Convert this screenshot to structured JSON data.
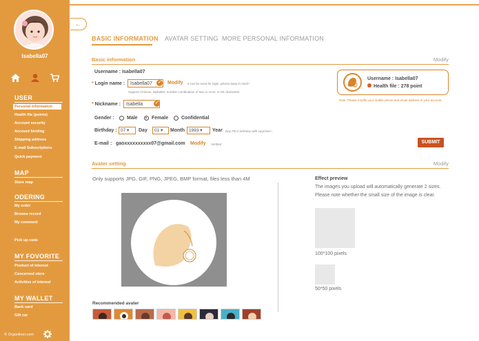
{
  "sidebar": {
    "username": "Isabella07",
    "sections": [
      {
        "title": "USER",
        "items": [
          "Personal information",
          "Health file (points)",
          "Account security",
          "Account binding",
          "Shipping address",
          "E-mail Subscriptions",
          "Quick payment"
        ]
      },
      {
        "title": "MAP",
        "items": [
          "Store map"
        ]
      },
      {
        "title": "ODERING",
        "items": [
          "My order",
          "Browse record",
          "My comment",
          "Pick up code"
        ]
      },
      {
        "title": "MY FOVORITE",
        "items": [
          "Product of interest",
          "Concerned store",
          "Activities of interest"
        ]
      },
      {
        "title": "MY WALLET",
        "items": [
          "Bank card",
          "Gift car"
        ]
      }
    ],
    "active_item": "Personal information",
    "footer": "© Organikon.com"
  },
  "tabs": [
    "BASIC INFORMATION",
    "AVATAR SETTING",
    "MORE PERSONAL INFORMATION"
  ],
  "active_tab": "BASIC INFORMATION",
  "basic": {
    "section_title": "Basic information",
    "modify": "Modify",
    "username_label": "Username :",
    "username_value": "Isabella07",
    "login_label": "Login name :",
    "login_value": "Isabella07",
    "login_modify": "Modify",
    "login_hint": "It can be used for login, please keep in mind~",
    "login_support": "Support Chinese, alphabet, number combination of two or more, 4~20 characters",
    "nickname_label": "Nickname :",
    "nickname_value": "Isabella",
    "gender_label": "Gender :",
    "gender_options": [
      "Male",
      "Female",
      "Confidential"
    ],
    "gender_selected": "Female",
    "birthday_label": "Birthday :",
    "day_value": "07",
    "day_label": "Day",
    "month_value": "01",
    "month_label": "Month",
    "year_value": "1993",
    "year_label": "Year",
    "birthday_hint": "Day Fill in birthday with surprises~",
    "email_label": "E-mail :",
    "email_value": "gaoxxxxxxxxxx07@gmail.com",
    "email_modify": "Modify",
    "email_status": "Verified",
    "submit": "SUBMIT"
  },
  "profile_card": {
    "username": "Username : Isabella07",
    "health": "Health file : 278 point",
    "note": "Note: Please modify your mobile phone and email address in your account."
  },
  "avatar": {
    "section_title": "Avater setting",
    "modify": "Modify",
    "support_note": "Only supports JPG, GIF, PNG, JPEG, BMP format, files less than 4M",
    "recommended_label": "Recommended avater",
    "effect_title": "Effect preview",
    "effect_line1": "The images you upload will automatically generate 2 sizes.",
    "effect_line2": "Please note whether the small size of the image is clear.",
    "big_caption": "100*100 pixels",
    "small_caption": "50*50 pixels"
  },
  "colors": {
    "accent": "#e39a3f",
    "submit": "#c9521f",
    "sidebar": "#e39a3f"
  },
  "icons": [
    "home-icon",
    "user-icon",
    "cart-icon",
    "gear-icon",
    "collapse-arrow-icon",
    "check-icon"
  ]
}
